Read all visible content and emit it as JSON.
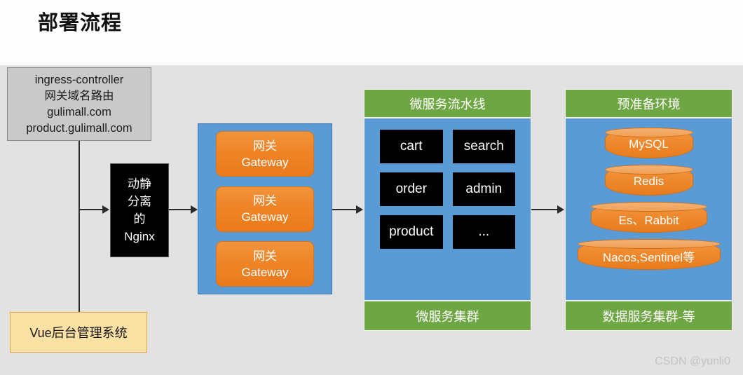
{
  "page": {
    "title": "部署流程",
    "watermark": "CSDN @yunli0"
  },
  "ingress": {
    "lines": [
      "ingress-controller",
      "网关域名路由",
      "gulimall.com",
      "product.gulimall.com"
    ]
  },
  "nginx": {
    "lines": [
      "动静",
      "分离",
      "的",
      "Nginx"
    ]
  },
  "vue": {
    "label": "Vue后台管理系统"
  },
  "gateway_panel": {
    "cards": [
      {
        "line1": "网关",
        "line2": "Gateway"
      },
      {
        "line1": "网关",
        "line2": "Gateway"
      },
      {
        "line1": "网关",
        "line2": "Gateway"
      }
    ]
  },
  "microservice_stack": {
    "header": "微服务流水线",
    "footer": "微服务集群",
    "services": [
      "cart",
      "search",
      "order",
      "admin",
      "product",
      "..."
    ]
  },
  "env_stack": {
    "header": "预准备环境",
    "footer": "数据服务集群-等",
    "items": [
      "MySQL",
      "Redis",
      "Es、Rabbit",
      "Nacos,Sentinel等"
    ]
  },
  "colors": {
    "background_top": "#fdfdfd",
    "background_bottom": "#e2e2e2",
    "panel_blue": "#5b9bd5",
    "header_green": "#6fa644",
    "accent_orange": "#ef8b30",
    "ingress_gray": "#c9c9c9",
    "vue_yellow": "#fce1a4",
    "service_black": "#000000",
    "connector": "#2b2b2b"
  }
}
